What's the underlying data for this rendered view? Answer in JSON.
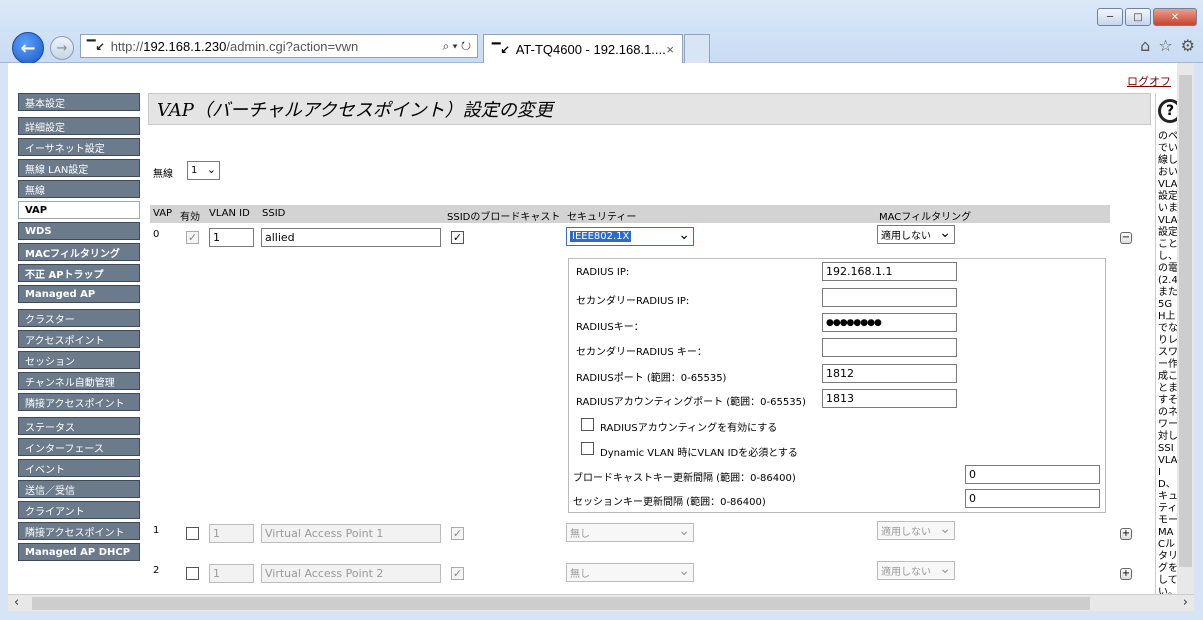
{
  "browser": {
    "url_prefix": "http://",
    "url_host": "192.168.1.230",
    "url_path": "/admin.cgi?action=vwn",
    "url_tools": "⌕ ▾ ↻",
    "tab_title": "AT-TQ4600 - 192.168.1....",
    "tab_close": "×",
    "logo": "▔↙"
  },
  "page": {
    "logout": "ログオフ",
    "title": "VAP（バーチャルアクセスポイント）設定の変更"
  },
  "sidebar": {
    "items": [
      {
        "label": "基本設定",
        "group": true
      },
      {
        "label": "詳細設定",
        "group": true
      },
      {
        "label": "イーサネット設定"
      },
      {
        "label": "無線 LAN設定"
      },
      {
        "label": "無線"
      },
      {
        "label": "VAP",
        "active": true
      },
      {
        "label": "WDS"
      },
      {
        "label": "MACフィルタリング"
      },
      {
        "label": "不正 APトラップ"
      },
      {
        "label": "Managed AP"
      },
      {
        "label": "クラスター",
        "group": true
      },
      {
        "label": "アクセスポイント"
      },
      {
        "label": "セッション"
      },
      {
        "label": "チャンネル自動管理"
      },
      {
        "label": "隣接アクセスポイント"
      },
      {
        "label": "ステータス",
        "group": true
      },
      {
        "label": "インターフェース"
      },
      {
        "label": "イベント"
      },
      {
        "label": "送信／受信"
      },
      {
        "label": "クライアント"
      },
      {
        "label": "隣接アクセスポイント"
      },
      {
        "label": "Managed AP DHCP"
      }
    ]
  },
  "radio": {
    "label": "無線",
    "value": "1"
  },
  "table": {
    "headers": {
      "vap": "VAP",
      "enabled": "有効",
      "vlan": "VLAN ID",
      "ssid": "SSID",
      "broadcast": "SSIDのブロードキャスト",
      "security": "セキュリティー",
      "mac": "MACフィルタリング"
    },
    "rows": [
      {
        "vap": "0",
        "vlan": "1",
        "ssid": "allied",
        "security": "IEEE802.1X",
        "mac": "適用しない",
        "toggle": "−"
      },
      {
        "vap": "1",
        "vlan": "1",
        "ssid": "Virtual Access Point 1",
        "security": "無し",
        "mac": "適用しない",
        "toggle": "+"
      },
      {
        "vap": "2",
        "vlan": "1",
        "ssid": "Virtual Access Point 2",
        "security": "無し",
        "mac": "適用しない",
        "toggle": "+"
      }
    ]
  },
  "radius": {
    "ip_label": "RADIUS IP:",
    "ip_value": "192.168.1.1",
    "sec_ip_label": "セカンダリーRADIUS IP:",
    "sec_ip_value": "",
    "key_label": "RADIUSキー：",
    "key_value": "●●●●●●●●",
    "sec_key_label": "セカンダリーRADIUS キー：",
    "sec_key_value": "",
    "port_label": "RADIUSポート (範囲：0-65535)",
    "port_value": "1812",
    "acct_port_label": "RADIUSアカウンティングポート (範囲：0-65535)",
    "acct_port_value": "1813",
    "acct_enable_label": "RADIUSアカウンティングを有効にする",
    "dyn_vlan_label": "Dynamic VLAN 時にVLAN IDを必須とする",
    "bcast_key_label": "ブロードキャストキー更新間隔 (範囲：0-86400)",
    "bcast_key_value": "0",
    "session_key_label": "セッションキー更新間隔 (範囲：0-86400)",
    "session_key_value": "0"
  },
  "help": {
    "text": "のペでい線しおいVLA設定いま VLA設定ことし、の電(2.4また5GH上でなりレスワー作成ことますそのネワー対しSSI VLA ID、キュティモー MACルタリグをしてい。"
  }
}
